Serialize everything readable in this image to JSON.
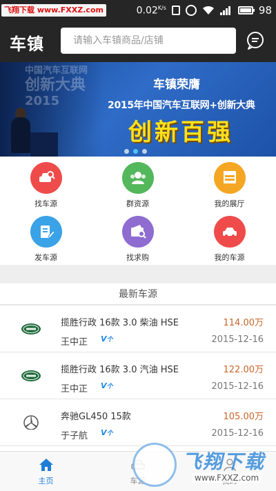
{
  "status_bar": {
    "watermark": "飞翔下载 www.FXXZ.com",
    "speed": "0.02",
    "speed_unit": "K/s",
    "battery": "98",
    "battery_level": 0.98
  },
  "header": {
    "logo": "车镇",
    "search_placeholder": "请输入车镇商品/店铺"
  },
  "banner": {
    "ghost_line1": "中国汽车互联网",
    "ghost_line2": "创新大典",
    "ghost_line3": "2015",
    "title": "车镇荣膺",
    "subtitle": "2015年中国汽车互联网+创新大典",
    "headline": "创新百强",
    "slides": 3,
    "active_slide": 1
  },
  "quick_links": [
    {
      "label": "找车源",
      "color": "#ef4b4b",
      "icon": "car-search-icon"
    },
    {
      "label": "群资源",
      "color": "#53b75b",
      "icon": "group-icon"
    },
    {
      "label": "我的展厅",
      "color": "#f5a623",
      "icon": "showroom-icon"
    },
    {
      "label": "发车源",
      "color": "#3aa2e6",
      "icon": "edit-icon"
    },
    {
      "label": "找求购",
      "color": "#8e6cd0",
      "icon": "wallet-search-icon"
    },
    {
      "label": "我的车源",
      "color": "#ef4b4b",
      "icon": "car-icon"
    }
  ],
  "listings_title": "最新车源",
  "listings": [
    {
      "brand": "land-rover-logo",
      "title": "揽胜行政 16款 3.0 柴油 HSE",
      "price": "114.00万",
      "seller": "王中正",
      "date": "2015-12-16"
    },
    {
      "brand": "land-rover-logo",
      "title": "揽胜行政 16款 3.0 汽油 HSE",
      "price": "122.00万",
      "seller": "王中正",
      "date": "2015-12-16"
    },
    {
      "brand": "mercedes-logo",
      "title": "奔驰GL450 15款",
      "price": "105.00万",
      "seller": "于子航",
      "date": "2015-12-16"
    }
  ],
  "tabs": [
    {
      "label": "主页",
      "icon": "home-icon",
      "active": true
    },
    {
      "label": "车源",
      "icon": "car-icon",
      "active": false
    },
    {
      "label": "我的",
      "icon": "user-icon",
      "active": false
    }
  ],
  "bottom_watermark": {
    "text": "飞翔下载",
    "url": "www.FXXZ.com"
  },
  "colors": {
    "header_bg": "#262626",
    "accent": "#1e7ed6",
    "price": "#c9652a"
  }
}
